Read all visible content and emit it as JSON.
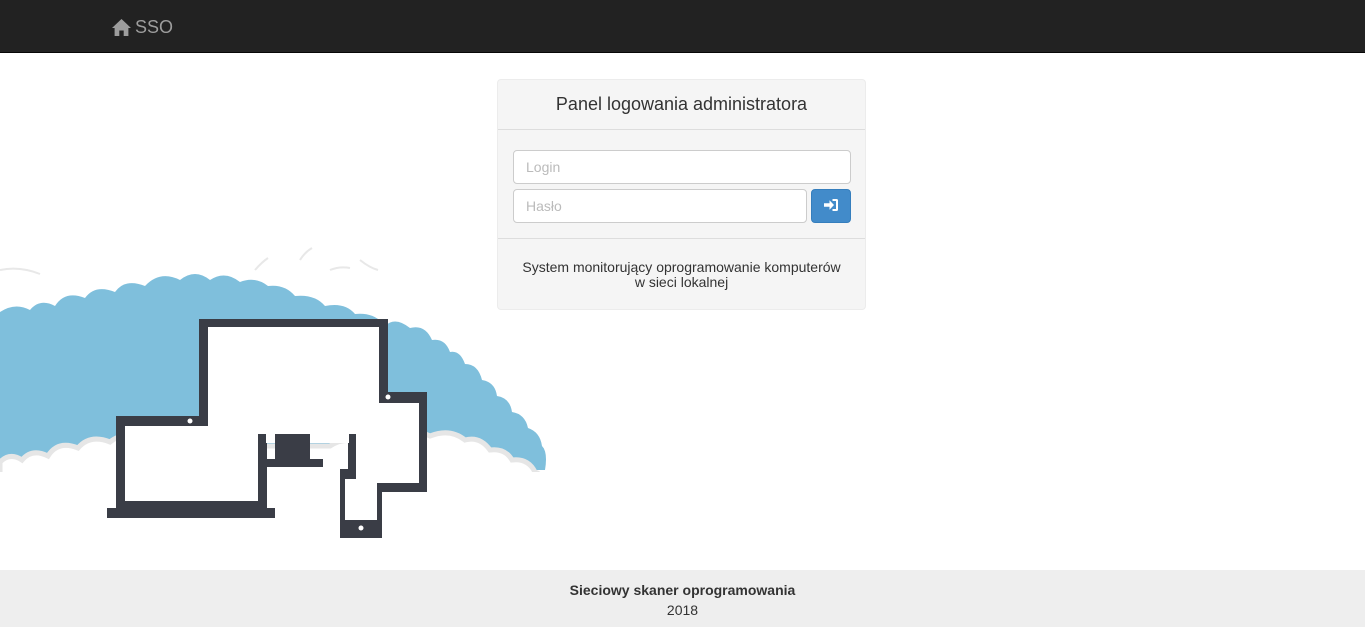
{
  "navbar": {
    "brand_label": "SSO",
    "brand_icon": "home-icon"
  },
  "login_panel": {
    "title": "Panel logowania administratora",
    "login_placeholder": "Login",
    "password_placeholder": "Hasło",
    "submit_icon": "sign-in-icon",
    "description_line1": "System monitorujący oprogramowanie komputerów",
    "description_line2": "w sieci lokalnej"
  },
  "illustration": {
    "name": "devices-cloud-illustration",
    "cloud_color": "#7fbfdc",
    "device_color": "#3a3d46"
  },
  "footer": {
    "title": "Sieciowy skaner oprogramowania",
    "year": "2018"
  },
  "colors": {
    "navbar_bg": "#222222",
    "brand_text": "#9d9d9d",
    "primary_button": "#428bca",
    "panel_bg": "#f5f5f5",
    "footer_bg": "#eeeeee"
  }
}
